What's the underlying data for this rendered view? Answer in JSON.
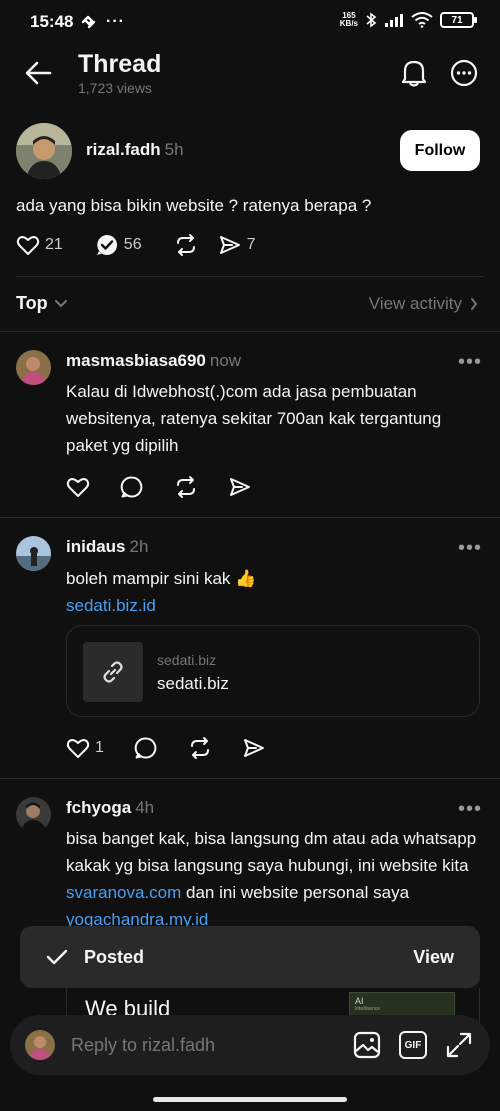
{
  "status_bar": {
    "time": "15:48",
    "net_speed_value": "165",
    "net_speed_unit": "KB/s",
    "battery": "71"
  },
  "header": {
    "title": "Thread",
    "views": "1,723 views"
  },
  "post": {
    "username": "rizal.fadh",
    "time": "5h",
    "follow_label": "Follow",
    "text": "ada yang bisa bikin website ? ratenya berapa ?",
    "likes": "21",
    "replies": "56",
    "shares": "7"
  },
  "sort": {
    "label": "Top",
    "view_activity": "View activity"
  },
  "replies": [
    {
      "username": "masmasbiasa690",
      "time": "now",
      "text": "Kalau di Idwebhost(.)com ada jasa pembuatan websitenya, ratenya sekitar 700an kak tergantung paket yg dipilih"
    },
    {
      "username": "inidaus",
      "time": "2h",
      "text": "boleh mampir sini kak 👍",
      "link": "sedati.biz.id",
      "card_domain": "sedati.biz",
      "card_title": "sedati.biz",
      "likes": "1"
    },
    {
      "username": "fchyoga",
      "time": "4h",
      "text_a": "bisa banget kak, bisa langsung dm atau ada whatsapp kakak yg bisa langsung saya hubungi, ini website kita ",
      "link_a": "svaranova.com",
      "text_b": " dan ini website personal saya ",
      "link_b": "yogachandra.my.id",
      "preview_heading": "We build",
      "preview_thumb_label": "AI",
      "preview_thumb_sub": "Intellisence"
    }
  ],
  "toast": {
    "label": "Posted",
    "action": "View"
  },
  "reply_bar": {
    "placeholder": "Reply to rizal.fadh",
    "gif_label": "GIF"
  }
}
